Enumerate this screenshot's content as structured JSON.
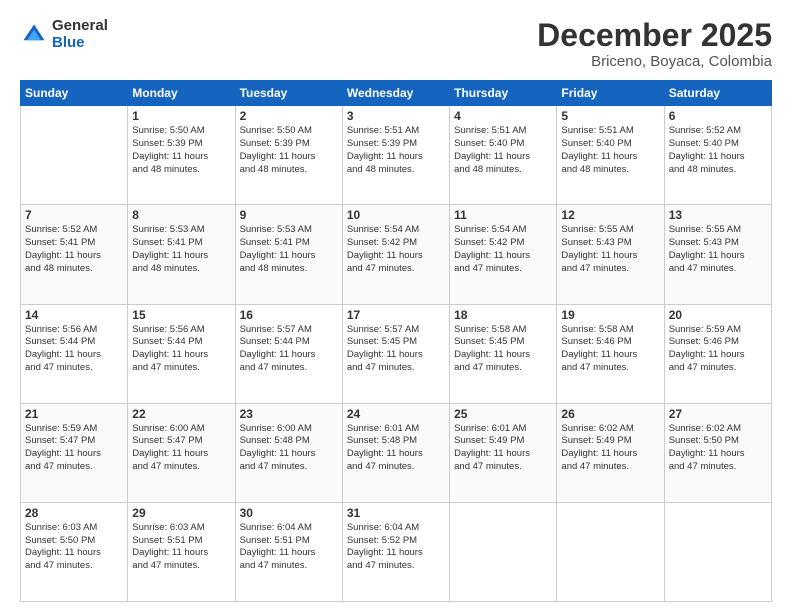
{
  "logo": {
    "general": "General",
    "blue": "Blue"
  },
  "title": "December 2025",
  "subtitle": "Briceno, Boyaca, Colombia",
  "weekdays": [
    "Sunday",
    "Monday",
    "Tuesday",
    "Wednesday",
    "Thursday",
    "Friday",
    "Saturday"
  ],
  "weeks": [
    [
      {
        "day": "",
        "info": ""
      },
      {
        "day": "1",
        "info": "Sunrise: 5:50 AM\nSunset: 5:39 PM\nDaylight: 11 hours\nand 48 minutes."
      },
      {
        "day": "2",
        "info": "Sunrise: 5:50 AM\nSunset: 5:39 PM\nDaylight: 11 hours\nand 48 minutes."
      },
      {
        "day": "3",
        "info": "Sunrise: 5:51 AM\nSunset: 5:39 PM\nDaylight: 11 hours\nand 48 minutes."
      },
      {
        "day": "4",
        "info": "Sunrise: 5:51 AM\nSunset: 5:40 PM\nDaylight: 11 hours\nand 48 minutes."
      },
      {
        "day": "5",
        "info": "Sunrise: 5:51 AM\nSunset: 5:40 PM\nDaylight: 11 hours\nand 48 minutes."
      },
      {
        "day": "6",
        "info": "Sunrise: 5:52 AM\nSunset: 5:40 PM\nDaylight: 11 hours\nand 48 minutes."
      }
    ],
    [
      {
        "day": "7",
        "info": "Sunrise: 5:52 AM\nSunset: 5:41 PM\nDaylight: 11 hours\nand 48 minutes."
      },
      {
        "day": "8",
        "info": "Sunrise: 5:53 AM\nSunset: 5:41 PM\nDaylight: 11 hours\nand 48 minutes."
      },
      {
        "day": "9",
        "info": "Sunrise: 5:53 AM\nSunset: 5:41 PM\nDaylight: 11 hours\nand 48 minutes."
      },
      {
        "day": "10",
        "info": "Sunrise: 5:54 AM\nSunset: 5:42 PM\nDaylight: 11 hours\nand 47 minutes."
      },
      {
        "day": "11",
        "info": "Sunrise: 5:54 AM\nSunset: 5:42 PM\nDaylight: 11 hours\nand 47 minutes."
      },
      {
        "day": "12",
        "info": "Sunrise: 5:55 AM\nSunset: 5:43 PM\nDaylight: 11 hours\nand 47 minutes."
      },
      {
        "day": "13",
        "info": "Sunrise: 5:55 AM\nSunset: 5:43 PM\nDaylight: 11 hours\nand 47 minutes."
      }
    ],
    [
      {
        "day": "14",
        "info": "Sunrise: 5:56 AM\nSunset: 5:44 PM\nDaylight: 11 hours\nand 47 minutes."
      },
      {
        "day": "15",
        "info": "Sunrise: 5:56 AM\nSunset: 5:44 PM\nDaylight: 11 hours\nand 47 minutes."
      },
      {
        "day": "16",
        "info": "Sunrise: 5:57 AM\nSunset: 5:44 PM\nDaylight: 11 hours\nand 47 minutes."
      },
      {
        "day": "17",
        "info": "Sunrise: 5:57 AM\nSunset: 5:45 PM\nDaylight: 11 hours\nand 47 minutes."
      },
      {
        "day": "18",
        "info": "Sunrise: 5:58 AM\nSunset: 5:45 PM\nDaylight: 11 hours\nand 47 minutes."
      },
      {
        "day": "19",
        "info": "Sunrise: 5:58 AM\nSunset: 5:46 PM\nDaylight: 11 hours\nand 47 minutes."
      },
      {
        "day": "20",
        "info": "Sunrise: 5:59 AM\nSunset: 5:46 PM\nDaylight: 11 hours\nand 47 minutes."
      }
    ],
    [
      {
        "day": "21",
        "info": "Sunrise: 5:59 AM\nSunset: 5:47 PM\nDaylight: 11 hours\nand 47 minutes."
      },
      {
        "day": "22",
        "info": "Sunrise: 6:00 AM\nSunset: 5:47 PM\nDaylight: 11 hours\nand 47 minutes."
      },
      {
        "day": "23",
        "info": "Sunrise: 6:00 AM\nSunset: 5:48 PM\nDaylight: 11 hours\nand 47 minutes."
      },
      {
        "day": "24",
        "info": "Sunrise: 6:01 AM\nSunset: 5:48 PM\nDaylight: 11 hours\nand 47 minutes."
      },
      {
        "day": "25",
        "info": "Sunrise: 6:01 AM\nSunset: 5:49 PM\nDaylight: 11 hours\nand 47 minutes."
      },
      {
        "day": "26",
        "info": "Sunrise: 6:02 AM\nSunset: 5:49 PM\nDaylight: 11 hours\nand 47 minutes."
      },
      {
        "day": "27",
        "info": "Sunrise: 6:02 AM\nSunset: 5:50 PM\nDaylight: 11 hours\nand 47 minutes."
      }
    ],
    [
      {
        "day": "28",
        "info": "Sunrise: 6:03 AM\nSunset: 5:50 PM\nDaylight: 11 hours\nand 47 minutes."
      },
      {
        "day": "29",
        "info": "Sunrise: 6:03 AM\nSunset: 5:51 PM\nDaylight: 11 hours\nand 47 minutes."
      },
      {
        "day": "30",
        "info": "Sunrise: 6:04 AM\nSunset: 5:51 PM\nDaylight: 11 hours\nand 47 minutes."
      },
      {
        "day": "31",
        "info": "Sunrise: 6:04 AM\nSunset: 5:52 PM\nDaylight: 11 hours\nand 47 minutes."
      },
      {
        "day": "",
        "info": ""
      },
      {
        "day": "",
        "info": ""
      },
      {
        "day": "",
        "info": ""
      }
    ]
  ]
}
